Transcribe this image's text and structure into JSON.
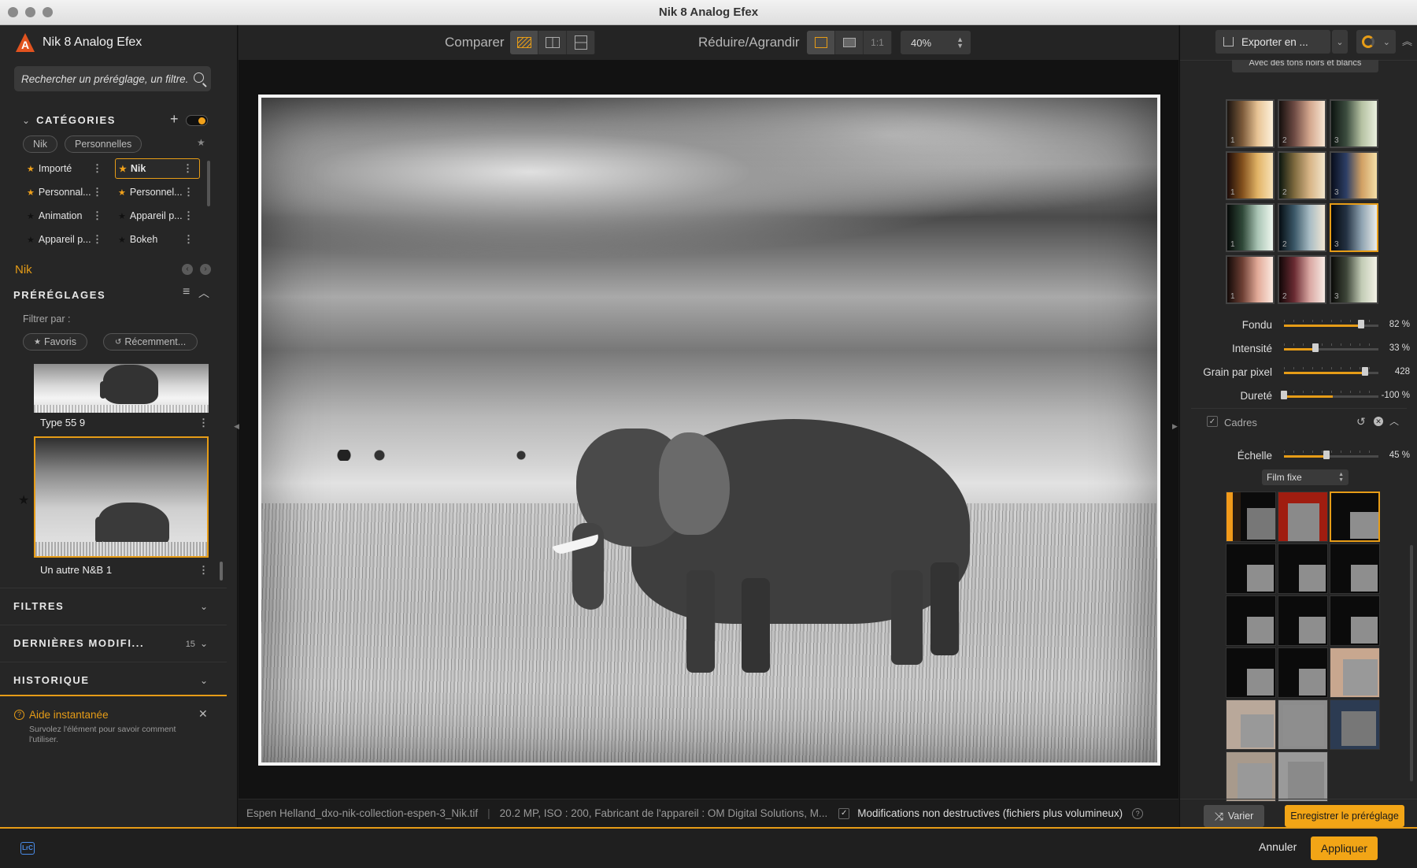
{
  "window": {
    "title": "Nik 8 Analog Efex"
  },
  "left": {
    "app_name": "Nik 8 Analog Efex",
    "search": {
      "placeholder": "Rechercher un préréglage, un filtre..."
    },
    "categories": {
      "title": "CATÉGORIES",
      "chips": [
        "Nik",
        "Personnelles"
      ],
      "items": [
        {
          "label": "Importé",
          "star": "orange"
        },
        {
          "label": "Nik",
          "star": "orange",
          "selected": true
        },
        {
          "label": "Personnal...",
          "star": "orange"
        },
        {
          "label": "Personnel...",
          "star": "orange"
        },
        {
          "label": "Animation",
          "star": "dark"
        },
        {
          "label": "Appareil p...",
          "star": "dark"
        },
        {
          "label": "Appareil p...",
          "star": "dark"
        },
        {
          "label": "Bokeh",
          "star": "dark"
        }
      ]
    },
    "current_category": "Nik",
    "presets": {
      "title": "PRÉRÉGLAGES",
      "filter_label": "Filtrer par :",
      "filters": [
        "Favoris",
        "Récemment..."
      ],
      "items": [
        {
          "label": "Type 55 9"
        },
        {
          "label": "Un autre N&B 1",
          "selected": true
        }
      ]
    },
    "sections": [
      {
        "title": "FILTRES",
        "count": ""
      },
      {
        "title": "DERNIÈRES MODIFI...",
        "count": "15"
      },
      {
        "title": "HISTORIQUE",
        "count": ""
      }
    ],
    "help": {
      "title": "Aide instantanée",
      "text": "Survolez l'élément pour savoir comment l'utiliser."
    }
  },
  "toolbar": {
    "compare_label": "Comparer",
    "zoom_label": "Réduire/Agrandir",
    "one_to_one": "1:1",
    "zoom_value": "40%"
  },
  "status": {
    "filename": "Espen Helland_dxo-nik-collection-espen-3_Nik.tif",
    "meta": "20.2 MP, ISO : 200, Fabricant de l'appareil : OM Digital Solutions, M...",
    "nondestructive": "Modifications non destructives (fichiers plus volumineux)"
  },
  "right": {
    "export_label": "Exporter en ...",
    "dropdown_top": "Avec des tons noirs et blancs",
    "sliders": [
      {
        "label": "Fondu",
        "value": "82 %",
        "pos": 0.82
      },
      {
        "label": "Intensité",
        "value": "33 %",
        "pos": 0.33
      },
      {
        "label": "Grain par pixel",
        "value": "428",
        "pos": 0.86
      },
      {
        "label": "Dureté",
        "value": "-100 %",
        "pos": 0.0
      }
    ],
    "frames": {
      "title": "Cadres",
      "scale_label": "Échelle",
      "scale_value": "45 %",
      "scale_pos": 0.45,
      "type": "Film fixe"
    },
    "vary_label": "Varier",
    "save_preset_label": "Enregistrer le préréglage"
  },
  "footer": {
    "lrc": "LrC",
    "cancel": "Annuler",
    "apply": "Appliquer"
  },
  "colors": {
    "accent": "#e69c17"
  }
}
